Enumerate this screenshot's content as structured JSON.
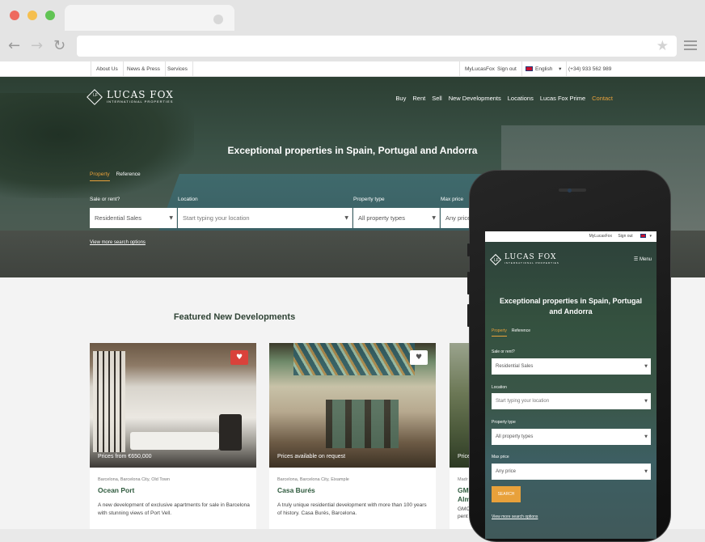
{
  "browser": {
    "colors": {
      "close": "#ee6a5e",
      "minimize": "#f5bf4f",
      "maximize": "#61c454"
    },
    "icons": [
      "back-arrow-icon",
      "forward-arrow-icon",
      "reload-icon",
      "star-icon",
      "hamburger-menu-icon"
    ]
  },
  "utilbar": {
    "links": [
      "About Us",
      "News & Press",
      "Services"
    ],
    "account": "MyLucasFox",
    "signout": "Sign out",
    "language": "English",
    "phone": "(+34) 933 562 989"
  },
  "brand": {
    "name": "LUCAS FOX",
    "tagline": "INTERNATIONAL PROPERTIES",
    "accent": "#e8a13b",
    "green": "#2e5a3d"
  },
  "nav": [
    "Buy",
    "Rent",
    "Sell",
    "New Developments",
    "Locations",
    "Lucas Fox Prime",
    "Contact"
  ],
  "hero": {
    "title": "Exceptional properties in Spain, Portugal and Andorra",
    "tabs": [
      "Property",
      "Reference"
    ],
    "labels": {
      "sale": "Sale or rent?",
      "location": "Location",
      "type": "Property type",
      "price": "Max price"
    },
    "values": {
      "sale": "Residential Sales",
      "location_placeholder": "Start typing your location",
      "type": "All property types",
      "price": "Any price"
    },
    "more": "View more search options"
  },
  "featured": {
    "title": "Featured New Developments",
    "cards": [
      {
        "price": "Prices from €650,000",
        "location": "Barcelona, Barcelona City, Old Town",
        "name": "Ocean Port",
        "desc": "A new development of exclusive apartments for sale in Barcelona with stunning views of Port Vell."
      },
      {
        "price": "Prices available on request",
        "location": "Barcelona, Barcelona City, Eixample",
        "name": "Casa Burés",
        "desc": "A truly unique residential development with more than 100 years of history. Casa Burés, Barcelona."
      },
      {
        "price": "Price",
        "location": "Madr",
        "name": "GMC Alm",
        "desc": "GMC pent"
      }
    ]
  },
  "mobile": {
    "account": "MyLucasFox",
    "signout": "Sign out",
    "menu": "Menu",
    "title": "Exceptional properties in Spain, Portugal and Andorra",
    "tabs": [
      "Property",
      "Reference"
    ],
    "labels": {
      "sale": "Sale or rent?",
      "location": "Location",
      "type": "Property type",
      "price": "Max price"
    },
    "values": {
      "sale": "Residential Sales",
      "location_placeholder": "Start typing your location",
      "type": "All property types",
      "price": "Any price"
    },
    "search": "SEARCH",
    "more": "View more search options"
  }
}
